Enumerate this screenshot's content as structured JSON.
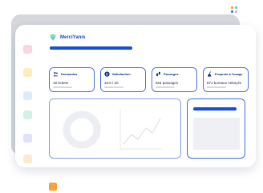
{
  "colors": {
    "accent": "#1a4fd8",
    "card_border": "#5a7fd9",
    "nav_dots": [
      "#f7c9d4",
      "#fbe7a3",
      "#cfe7fb",
      "#bfeedd",
      "#d6d8fb",
      "#fde3b8"
    ],
    "orange": "#f7a43a"
  },
  "header": {
    "brand": "MerciYanis",
    "brand_icon": "diamond-icon"
  },
  "stats": [
    {
      "icon": "users-icon",
      "title": "Demandes",
      "value": "18 tickets"
    },
    {
      "icon": "smiley-icon",
      "title": "Satisfaction",
      "value": "18.8 / 20"
    },
    {
      "icon": "footsteps-icon",
      "title": "Passages",
      "value": "664 passages"
    },
    {
      "icon": "broom-icon",
      "title": "Propreté à l'usage",
      "value": "871 bureaux nettoyés"
    }
  ]
}
